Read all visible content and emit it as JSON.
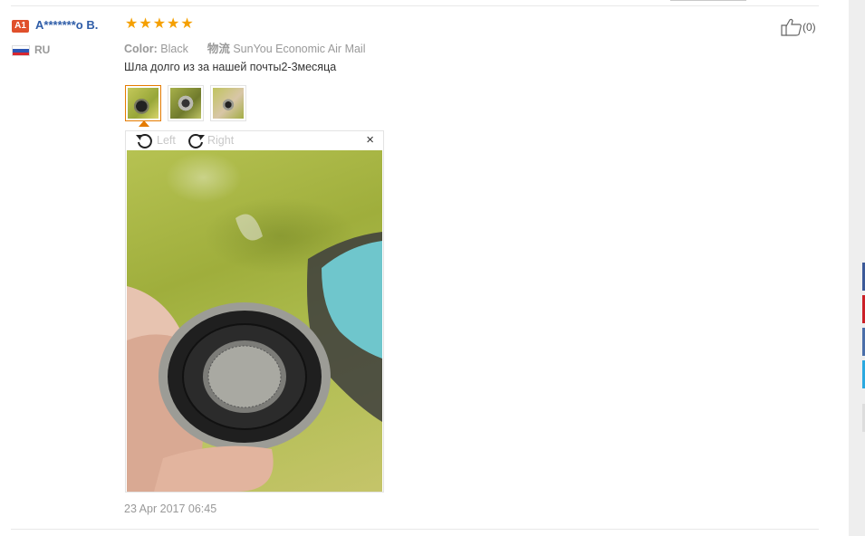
{
  "review": {
    "level": "A1",
    "username": "A*******o B.",
    "rating": 5,
    "country": "RU",
    "color_label": "Color:",
    "color_value": "Black",
    "shipping_label": "物流",
    "shipping_value": "SunYou Economic Air Mail",
    "text": "Шла долго из за нашей почты2-3месяца",
    "likes": "(0)",
    "date": "23 Apr 2017 06:45"
  },
  "viewer": {
    "rotate_left": "Left",
    "rotate_right": "Right",
    "close": "×"
  },
  "thumbnails": [
    "photo-1",
    "photo-2",
    "photo-3"
  ],
  "colors": {
    "username": "#2f5da8",
    "badge": "#e0502c",
    "star": "#f5a000",
    "active_border": "#e57b00",
    "share_buttons": [
      "#3b5998",
      "#cb2027",
      "#4a6ea9",
      "#2aa9e0",
      "#dddddd"
    ]
  },
  "icons": {
    "stars": "star-icon",
    "like": "thumbs-up-icon",
    "rotate_left": "rotate-left-icon",
    "rotate_right": "rotate-right-icon",
    "close": "close-icon",
    "flag": "russia-flag-icon"
  }
}
